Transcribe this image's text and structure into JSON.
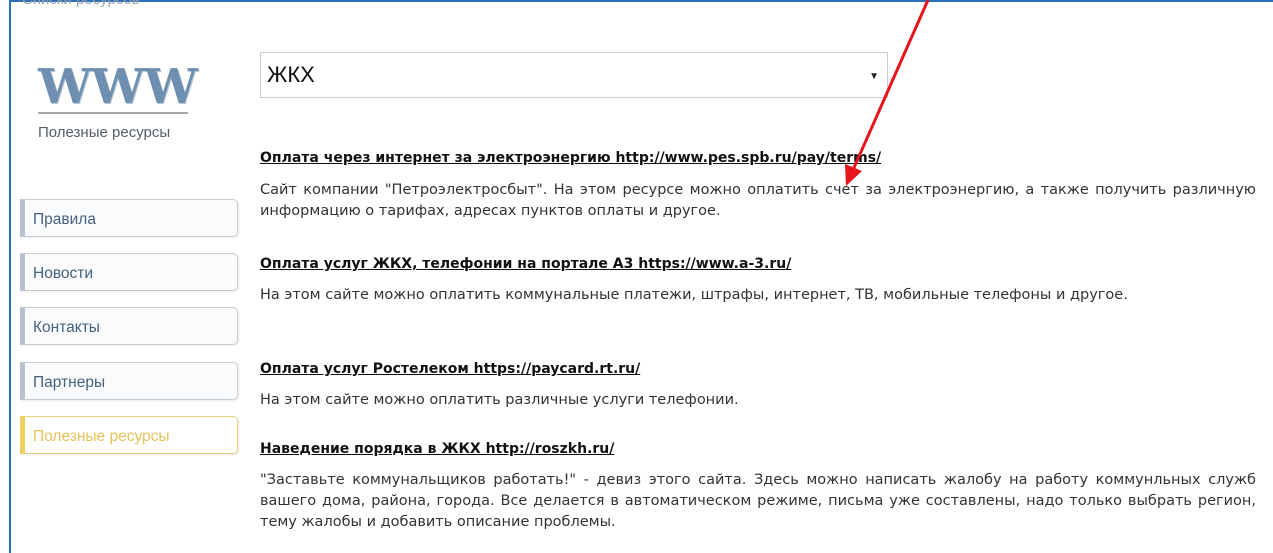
{
  "header": {
    "cut_heading": "Списки ресурсов"
  },
  "logo": {
    "www": "WWW",
    "subtitle": "Полезные ресурсы"
  },
  "sidebar": {
    "items": [
      {
        "label": "Правила",
        "active": false
      },
      {
        "label": "Новости",
        "active": false
      },
      {
        "label": "Контакты",
        "active": false
      },
      {
        "label": "Партнеры",
        "active": false
      },
      {
        "label": "Полезные ресурсы",
        "active": true
      }
    ]
  },
  "category_select": {
    "selected": "ЖКХ"
  },
  "resources": [
    {
      "title": "Оплата через интернет за электроэнергию http://www.pes.spb.ru/pay/terms/",
      "description": "Сайт компании \"Петроэлектросбыт\". На этом ресурсе можно оплатить счет за электроэнергию, а также получить различную информацию о тарифах, адресах пунктов оплаты и другое."
    },
    {
      "title": "Оплата услуг ЖКХ, телефонии на портале А3 https://www.a-3.ru/",
      "description": "На этом сайте можно оплатить коммунальные платежи, штрафы, интернет, ТВ, мобильные телефоны и другое."
    },
    {
      "title": "Оплата услуг Ростелеком https://paycard.rt.ru/",
      "description": "На этом сайте можно оплатить различные услуги телефонии."
    },
    {
      "title": "Наведение порядка в ЖКХ http://roszkh.ru/",
      "description": "\"Заставьте коммунальщиков работать!\" - девиз этого сайта. Здесь можно написать жалобу на работу коммунльных служб вашего дома, района, города. Все делается в автоматическом режиме, письма уже составлены, надо только выбрать регион, тему жалобы и добавить описание проблемы."
    }
  ],
  "colors": {
    "frame": "#2f6fb5",
    "nav_text": "#44617e",
    "active": "#e6c15a",
    "annotation_arrow": "#e8141b"
  }
}
